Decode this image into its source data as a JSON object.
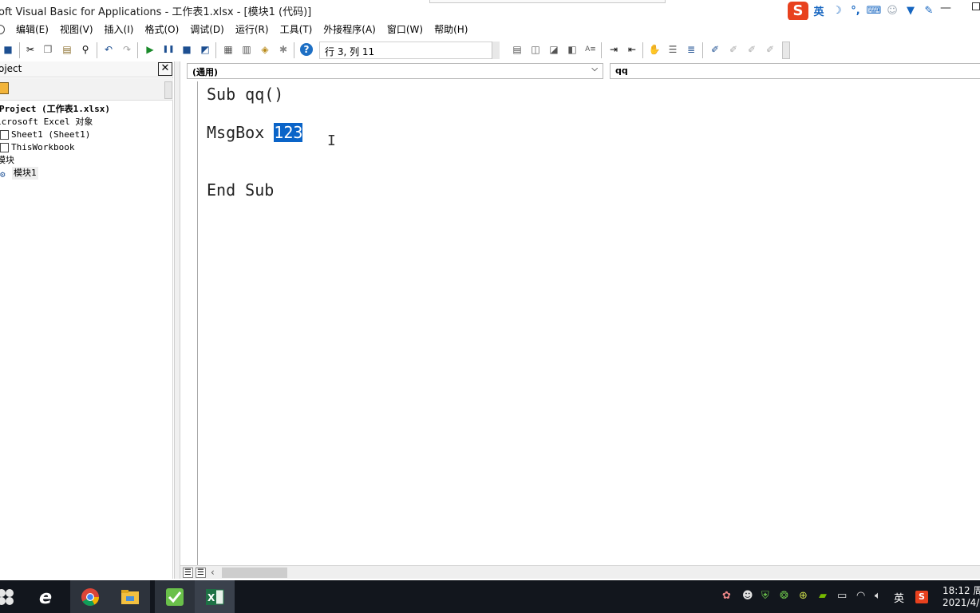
{
  "window": {
    "title": "oft Visual Basic for Applications - 工作表1.xlsx - [模块1 (代码)]"
  },
  "ime": {
    "mode_label": "英",
    "icons": [
      "sogou-logo-icon",
      "moon-icon",
      "punctuation-icon",
      "keyboard-icon",
      "user-icon",
      "shirt-icon",
      "wrench-icon"
    ]
  },
  "menu": {
    "items": [
      {
        "label": "编辑(E)"
      },
      {
        "label": "视图(V)"
      },
      {
        "label": "插入(I)"
      },
      {
        "label": "格式(O)"
      },
      {
        "label": "调试(D)"
      },
      {
        "label": "运行(R)"
      },
      {
        "label": "工具(T)"
      },
      {
        "label": "外接程序(A)"
      },
      {
        "label": "窗口(W)"
      },
      {
        "label": "帮助(H)"
      }
    ]
  },
  "toolbar": {
    "position_text": "行 3, 列 11"
  },
  "project": {
    "title": "oject",
    "close_glyph": "✕",
    "tree": [
      {
        "text": "Project (工作表1.xlsx)"
      },
      {
        "text": "icrosoft Excel 对象"
      },
      {
        "text": "Sheet1 (Sheet1)"
      },
      {
        "text": "ThisWorkbook"
      },
      {
        "text": "模块"
      },
      {
        "text": "模块1"
      }
    ]
  },
  "code_window": {
    "object_selector": "(通用)",
    "procedure_selector": "qq",
    "lines": {
      "line1": "Sub qq()",
      "line2_prefix": "MsgBox ",
      "line2_selected": "123",
      "line3": "End Sub"
    }
  },
  "taskbar": {
    "apps": [
      "ie-icon",
      "chrome-icon",
      "file-explorer-icon",
      "green-check-app-icon",
      "excel-icon"
    ],
    "tray_lang": "英",
    "tray_sogou": "S",
    "clock_time": "18:12 周",
    "clock_date": "2021/4/"
  },
  "colors": {
    "selection": "#0a64c8",
    "taskbar": "#12161d",
    "sogou": "#e8411e"
  }
}
